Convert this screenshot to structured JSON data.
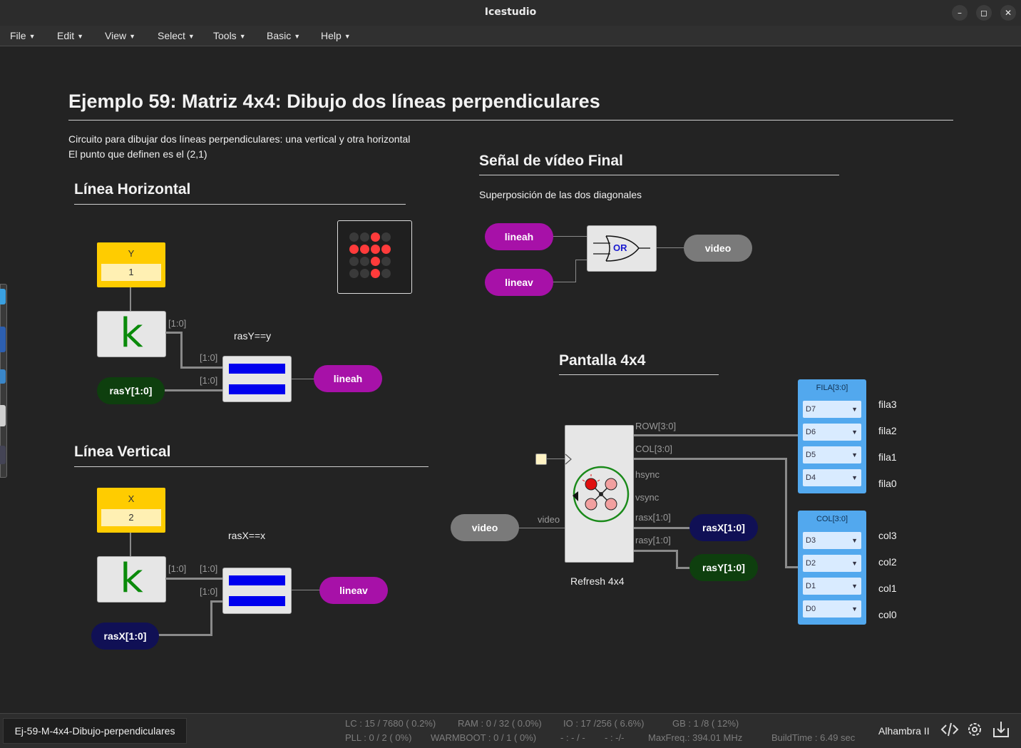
{
  "window": {
    "title": "Icestudio",
    "min": "–",
    "max": "◻",
    "close": "✕"
  },
  "menu": [
    "File",
    "Edit",
    "View",
    "Select",
    "Tools",
    "Basic",
    "Help"
  ],
  "doc": {
    "title": "Ejemplo 59: Matriz 4x4: Dibujo dos líneas perpendiculares",
    "desc1": "Circuito para dibujar dos líneas perpendiculares: una vertical y otra horizontal",
    "desc2": "El punto que definen es el (2,1)"
  },
  "horiz": {
    "heading": "Línea Horizontal",
    "const_name": "Y",
    "const_value": "1",
    "k": "k",
    "cmp_label": "rasY==y",
    "w1": "[1:0]",
    "w2": "[1:0]",
    "w3": "[1:0]",
    "input": "rasY[1:0]",
    "output": "lineah"
  },
  "vert": {
    "heading": "Línea Vertical",
    "const_name": "X",
    "const_value": "2",
    "k": "k",
    "cmp_label": "rasX==x",
    "w1": "[1:0]",
    "w2": "[1:0]",
    "w3": "[1:0]",
    "input": "rasX[1:0]",
    "output": "lineav"
  },
  "final": {
    "heading": "Señal de vídeo Final",
    "desc": "Superposición de las dos diagonales",
    "in1": "lineah",
    "in2": "lineav",
    "gate": "OR",
    "out": "video"
  },
  "screen": {
    "heading": "Pantalla 4x4",
    "video_in": "video",
    "video_wire": "video",
    "block_label": "Refresh 4x4",
    "ports": [
      "ROW[3:0]",
      "COL[3:0]",
      "hsync",
      "vsync",
      "rasx[1:0]",
      "rasy[1:0]"
    ],
    "rasx_out": "rasX[1:0]",
    "rasy_out": "rasY[1:0]",
    "fila_name": "FILA[3:0]",
    "fila_pins": [
      "D7",
      "D6",
      "D5",
      "D4"
    ],
    "fila_labels": [
      "fila3",
      "fila2",
      "fila1",
      "fila0"
    ],
    "col_name": "COL[3:0]",
    "col_pins": [
      "D3",
      "D2",
      "D1",
      "D0"
    ],
    "col_labels": [
      "col3",
      "col2",
      "col1",
      "col0"
    ]
  },
  "led_matrix": [
    [
      0,
      0,
      1,
      0
    ],
    [
      1,
      1,
      1,
      1
    ],
    [
      0,
      0,
      1,
      0
    ],
    [
      0,
      0,
      1,
      0
    ]
  ],
  "colors": {
    "led_on": "#ff3b3b",
    "led_off": "#3a3a3a"
  },
  "status": {
    "file": "Ej-59-M-4x4-Dibujo-perpendiculares",
    "lc": "LC : 15 / 7680 ( 0.2%)",
    "ram": "RAM : 0 / 32 ( 0.0%)",
    "io": "IO :  17 /256  ( 6.6%)",
    "gb": "GB :  1 /8  ( 12%)",
    "pll": "PLL : 0 / 2 ( 0%)",
    "warmboot": "WARMBOOT : 0 / 1 ( 0%)",
    "blank1": "- : - / -",
    "blank2": "- :  -/-",
    "maxfreq": "MaxFreq.:  394.01 MHz",
    "buildtime": "BuildTime :   6.49 sec",
    "board": "Alhambra II"
  }
}
